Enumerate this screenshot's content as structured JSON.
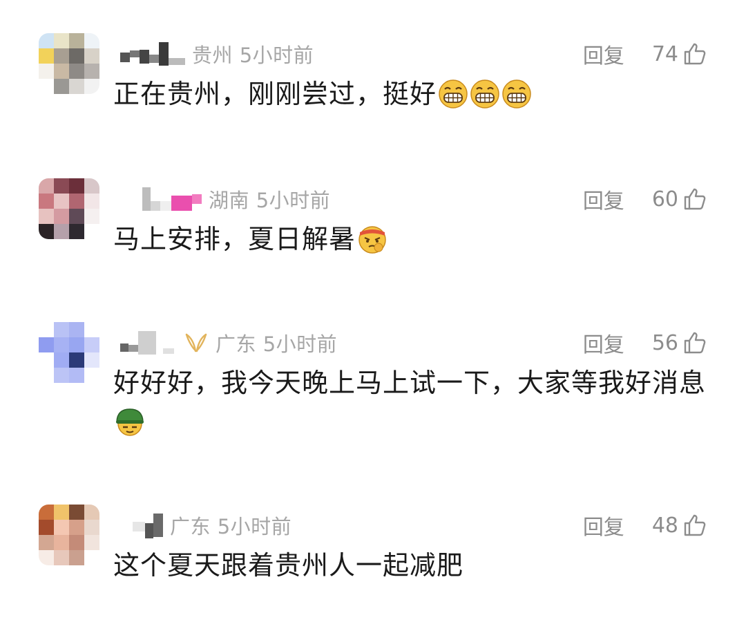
{
  "comments": [
    {
      "location": "贵州",
      "time": "5小时前",
      "reply_label": "回复",
      "likes": "74",
      "text": "正在贵州，刚刚尝过，挺好",
      "emojis": [
        "grin-emoji",
        "grin-emoji",
        "grin-emoji"
      ]
    },
    {
      "location": "湖南",
      "time": "5小时前",
      "reply_label": "回复",
      "likes": "60",
      "text": "马上安排，夏日解暑",
      "emojis": [
        "determined-emoji"
      ]
    },
    {
      "location": "广东",
      "time": "5小时前",
      "reply_label": "回复",
      "likes": "56",
      "text": "好好好，我今天晚上马上试一下，大家等我好消息",
      "emojis": [
        "helmet-emoji"
      ]
    },
    {
      "location": "广东",
      "time": "5小时前",
      "reply_label": "回复",
      "likes": "48",
      "text": "这个夏天跟着贵州人一起减肥",
      "emojis": []
    }
  ],
  "colors": {
    "meta_gray": "#a6a6a6",
    "action_gray": "#8c8c8c",
    "text": "#1a1a1a",
    "badge_gold": "#e2b45c"
  }
}
